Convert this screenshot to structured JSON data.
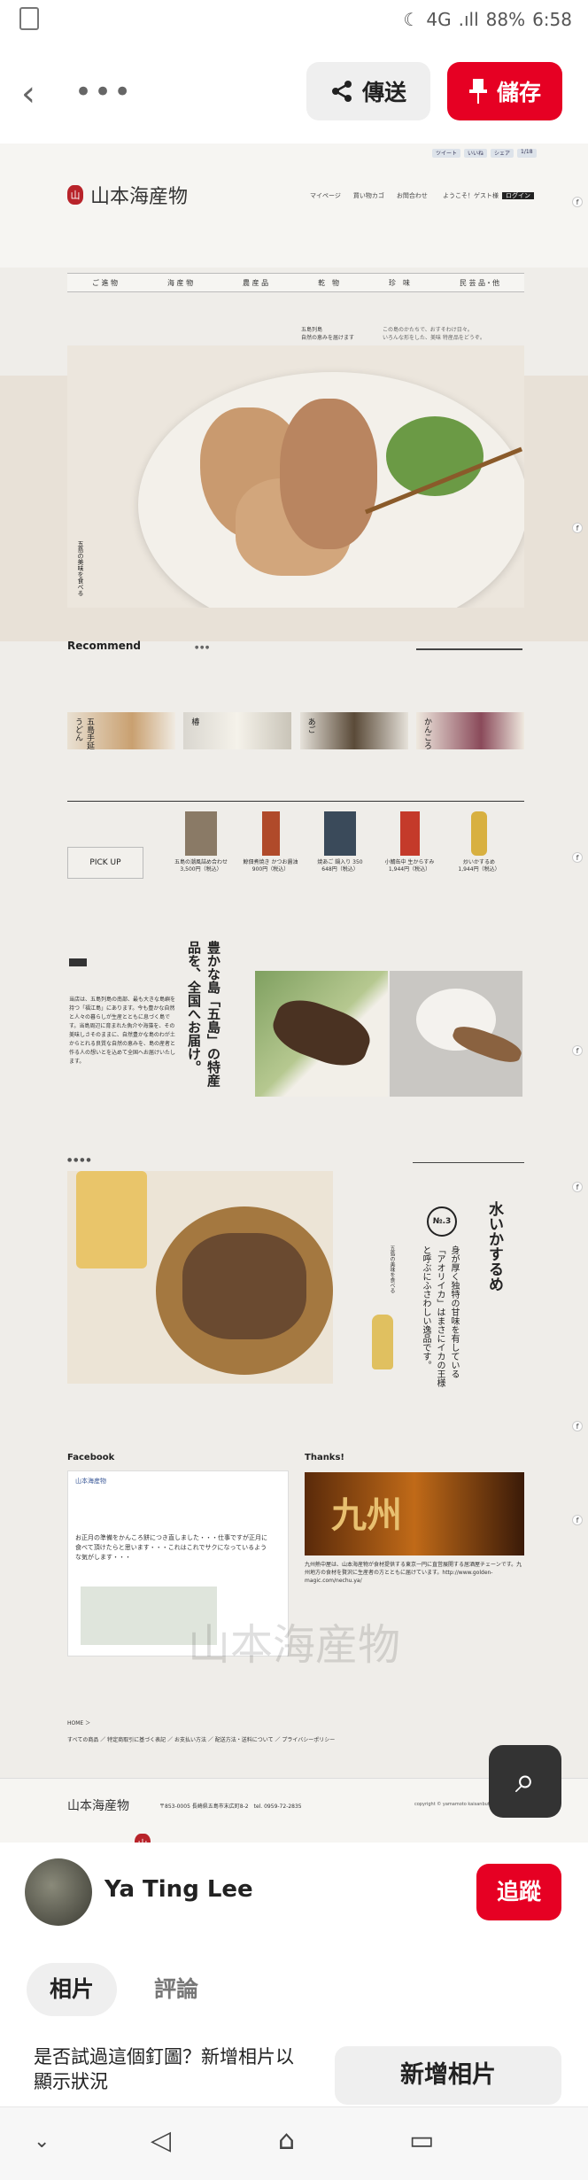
{
  "statusbar": {
    "network": "4G",
    "signal": ".ıll",
    "battery": "88%",
    "time": "6:58"
  },
  "topbar": {
    "send_label": "傳送",
    "save_label": "儲存"
  },
  "pin": {
    "logo": "山本海産物",
    "logo_seal": "山",
    "share": [
      "ツイート",
      "いいね",
      "シェア",
      "1/18"
    ],
    "nav_links": [
      "マイページ",
      "買い物カゴ",
      "お問合わせ"
    ],
    "welcome": "ようこそ！ゲスト様",
    "login": "ログイン",
    "categories": [
      "ご 進 物",
      "海 産 物",
      "農 産 品",
      "乾　物",
      "珍　味",
      "民 芸 品・他"
    ],
    "intro_mid": "五島列島\n自然の恵みを届けます",
    "intro_right": "この島のかたちで、おすそわけ日々。\nいろんな形をした、美味 特産品をどうぞ。",
    "hero_vtext": "五島の美味を食べる",
    "recommend": "Recommend",
    "thumbs": [
      "五島手延うどん",
      "椿",
      "あご",
      "かんころ"
    ],
    "pickup": "PICK UP",
    "products": [
      {
        "name": "五島の潮風詰め合わせ",
        "price": "3,500円（税込）"
      },
      {
        "name": "鯨佃煮焼き かつお醤油",
        "price": "900円（税込）"
      },
      {
        "name": "焼あご 鍋入り 350",
        "price": "648円（税込）"
      },
      {
        "name": "小鯖缶中 生からすみ",
        "price": "1,944円（税込）"
      },
      {
        "name": "炒いかするめ",
        "price": "1,944円（税込）"
      }
    ],
    "feature_title": "豊かな島「五島」の特産品を、全国へお届け。",
    "feature_body": "当店は、五島列島の南部、最も大きな島嶼を持つ「福江島」にあります。今も豊かな自然と人々の暮らしが生産とともに息づく島です。当島周辺に育まれた魚介や海藻を、その美味しさそのままに、自然豊かな島のわが土からとれる良質な自然の恵みを、島の産者と作る人の想いとを込めて全国へお届けいたします。",
    "no3": "№.3",
    "sec3_title": "水いかするめ",
    "sec3_sub": "身が厚く独特の甘味を有している「アオリイカ」はまさにイカの王様と呼ぶにふさわしい逸品です。",
    "facebook": "Facebook",
    "fb_page": "山本海産物",
    "fb_post": "お正月の準備をかんころ餅につき直しました・・・仕事ですが正月に食べて頂けたらと思います・・・これはこれでサクになっているような気がします・・・",
    "thanks": "Thanks!",
    "thanks_img_text": "九州",
    "thanks_text": "九州熱中屋は、山本海産物が食材提供する東京一円に直営展開する居酒屋チェーンです。九州地方の食材を贅沢に生産者の方とともに届けています。http://www.golden-magic.com/nechu.ya/",
    "home": "HOME ＞",
    "foot_links": "すべての商品 ／ 特定商取引に基づく表記 ／ お支払い方法 ／ 配送方法・送料について ／ プライバシーポリシー",
    "foot_logo": "山本海産物",
    "foot_addr": "〒853-0005 長崎県五島市末広町8-2　tel. 0959-72-2835",
    "foot_copy": "copyright © yamamoto kaisanbutsu"
  },
  "user": {
    "name": "Ya Ting Lee",
    "follow": "追蹤"
  },
  "tabs": {
    "photos": "相片",
    "comments": "評論"
  },
  "prompt": {
    "text": "是否試過這個釘圖？新增相片以顯示狀況",
    "add_photo": "新增相片"
  }
}
